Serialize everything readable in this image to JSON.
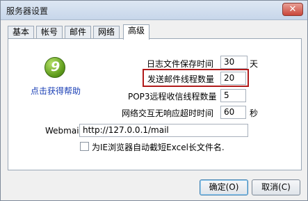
{
  "window": {
    "title": "服务器设置",
    "close_symbol": "✕"
  },
  "tabs": [
    {
      "label": "基本"
    },
    {
      "label": "帐号"
    },
    {
      "label": "邮件"
    },
    {
      "label": "网络"
    },
    {
      "label": "高级",
      "active": true
    }
  ],
  "sidebar": {
    "help_link": "点击获得帮助",
    "logo_glyph": "9"
  },
  "settings": {
    "log_retention": {
      "label": "日志文件保存时间",
      "value": "30",
      "unit": "天"
    },
    "send_threads": {
      "label": "发送邮件线程数量",
      "value": "20"
    },
    "pop3_threads": {
      "label": "POP3远程收信线程数量",
      "value": "5"
    },
    "network_timeout": {
      "label": "网络交互无响应超时时间",
      "value": "60",
      "unit": "秒"
    },
    "webmail": {
      "label": "Webmail",
      "value": "http://127.0.0.1/mail"
    },
    "ie_truncate": {
      "label": "为IE浏览器自动截短Excel长文件名.",
      "checked": false
    }
  },
  "buttons": {
    "ok": "确定(O)",
    "cancel": "取消(C)"
  },
  "colors": {
    "highlight_border": "#b01a1a",
    "link": "#1a3fb5",
    "logo_green": "#5f9c1c"
  }
}
